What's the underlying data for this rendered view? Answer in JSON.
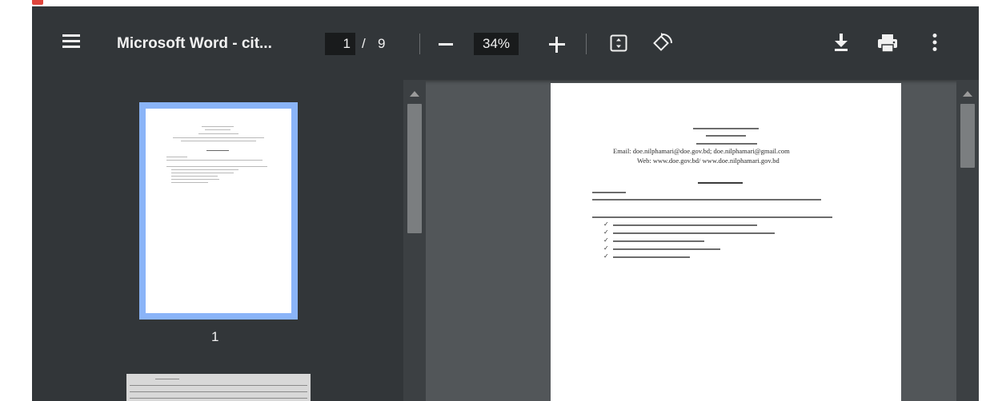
{
  "document": {
    "title": "Microsoft Word - cit...",
    "current_page": "1",
    "page_separator": "/",
    "total_pages": "9",
    "zoom": "34%"
  },
  "toolbar": {
    "menu_icon": "hamburger-menu-icon",
    "zoom_out_icon": "minus-icon",
    "zoom_in_icon": "plus-icon",
    "fit_icon": "fit-to-page-icon",
    "rotate_icon": "rotate-icon",
    "download_icon": "download-icon",
    "print_icon": "print-icon",
    "more_icon": "more-vertical-icon"
  },
  "thumbnails": [
    {
      "label": "1",
      "selected": true
    },
    {
      "label": "",
      "selected": false
    }
  ],
  "page_content": {
    "email_line": "Email: doe.nilphamari@doe.gov.bd; doe.nilphamari@gmail.com",
    "web_line": "Web: www.doe.gov.bd/ www.doe.nilphamari.gov.bd"
  },
  "colors": {
    "toolbar_bg": "#323639",
    "viewer_bg": "#525659",
    "thumbnail_highlight": "#8ab4f8"
  }
}
